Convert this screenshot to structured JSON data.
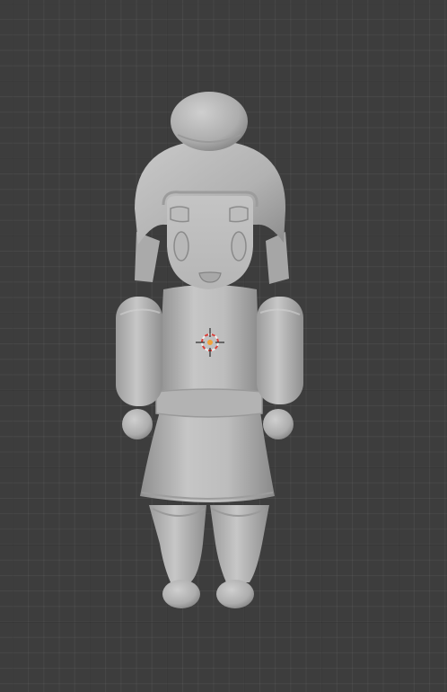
{
  "viewport": {
    "background_color": "#3d3d3d",
    "grid_visible": true,
    "shading": "solid",
    "object_color": "#b9b9b9"
  },
  "model": {
    "object": "chibi-character",
    "parts": [
      "hair-bun",
      "head",
      "hair-sides",
      "face",
      "torso",
      "arms",
      "hands",
      "belt",
      "skirt",
      "legs",
      "feet"
    ]
  },
  "cursor_3d": {
    "icon": "3d-cursor-icon",
    "color_ring_red": "#d9403a",
    "color_ring_white": "#eeeeee",
    "center_color": "#f2a23a"
  }
}
